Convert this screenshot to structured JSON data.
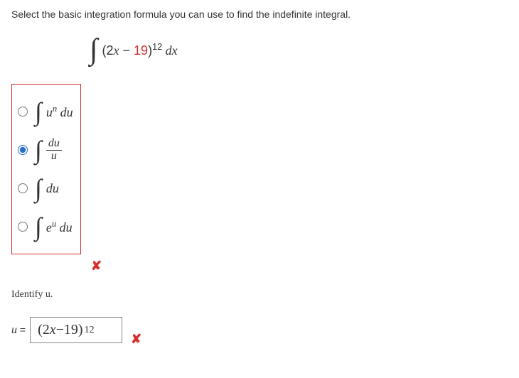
{
  "prompt": "Select the basic integration formula you can use to find the indefinite integral.",
  "integral": {
    "expr_open": "(2",
    "var1": "x",
    "minus": " − ",
    "num": "19",
    "close": ")",
    "exp": "12",
    "dx_d": " d",
    "dx_x": "x"
  },
  "options": {
    "opt1": {
      "u": "u",
      "n": "n",
      "du_d": " d",
      "du_u": "u"
    },
    "opt2": {
      "du_d": "d",
      "du_u": "u",
      "den_u": "u"
    },
    "opt3": {
      "du_d": "d",
      "du_u": "u"
    },
    "opt4": {
      "e": "e",
      "u": "u",
      "du_d": " d",
      "du_u": "u"
    }
  },
  "feedback": {
    "wrong_mark": "✘"
  },
  "identify": "Identify u.",
  "u_eq": {
    "u": "u",
    "eq": " = "
  },
  "answer": {
    "open": "(2",
    "var": "x",
    "minus": " − ",
    "num": "19",
    "close": ")",
    "exp": "12"
  }
}
